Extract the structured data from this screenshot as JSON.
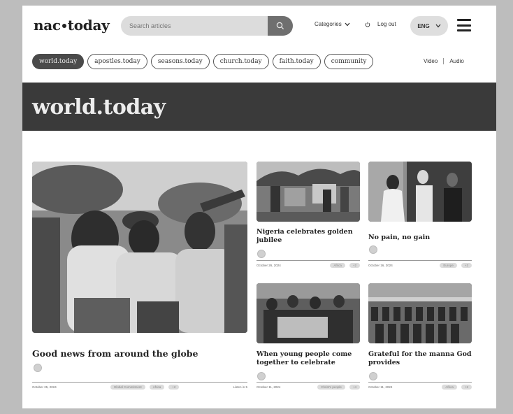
{
  "header": {
    "logo_left": "nac",
    "logo_right": "today",
    "search_placeholder": "Search articles",
    "categories_label": "Categories",
    "login_label": "Log out",
    "language": "ENG"
  },
  "nav": {
    "chips": [
      "world.today",
      "apostles.today",
      "seasons.today",
      "church.today",
      "faith.today",
      "community"
    ],
    "active_chip": "world.today",
    "video_label": "Video",
    "audio_label": "Audio"
  },
  "banner": {
    "title": "world.today"
  },
  "articles": {
    "main": {
      "title": "Good news from around the globe",
      "date": "October 25, 2024",
      "tags": [
        "Global Commitment",
        "Africa",
        "+2"
      ],
      "read_time": "Listen in 5"
    },
    "a1": {
      "title": "Nigeria celebrates golden jubilee",
      "date": "October 26, 2024",
      "tags": [
        "Africa",
        "+2"
      ]
    },
    "a2": {
      "title": "No pain, no gain",
      "date": "October 16, 2024",
      "tags": [
        "Europe",
        "+2"
      ]
    },
    "a3": {
      "title": "When young people come together to celebrate",
      "date": "October 11, 2024",
      "tags": [
        "Christ's people",
        "+4"
      ]
    },
    "a4": {
      "title": "Grateful for the manna God provides",
      "date": "October 11, 2024",
      "tags": [
        "Africa",
        "+2"
      ]
    }
  },
  "colors": {
    "banner_bg": "#3a3a3a",
    "page_bg": "#ffffff",
    "outer_bg": "#bdbdbd",
    "active_chip_bg": "#4a4a4a"
  }
}
